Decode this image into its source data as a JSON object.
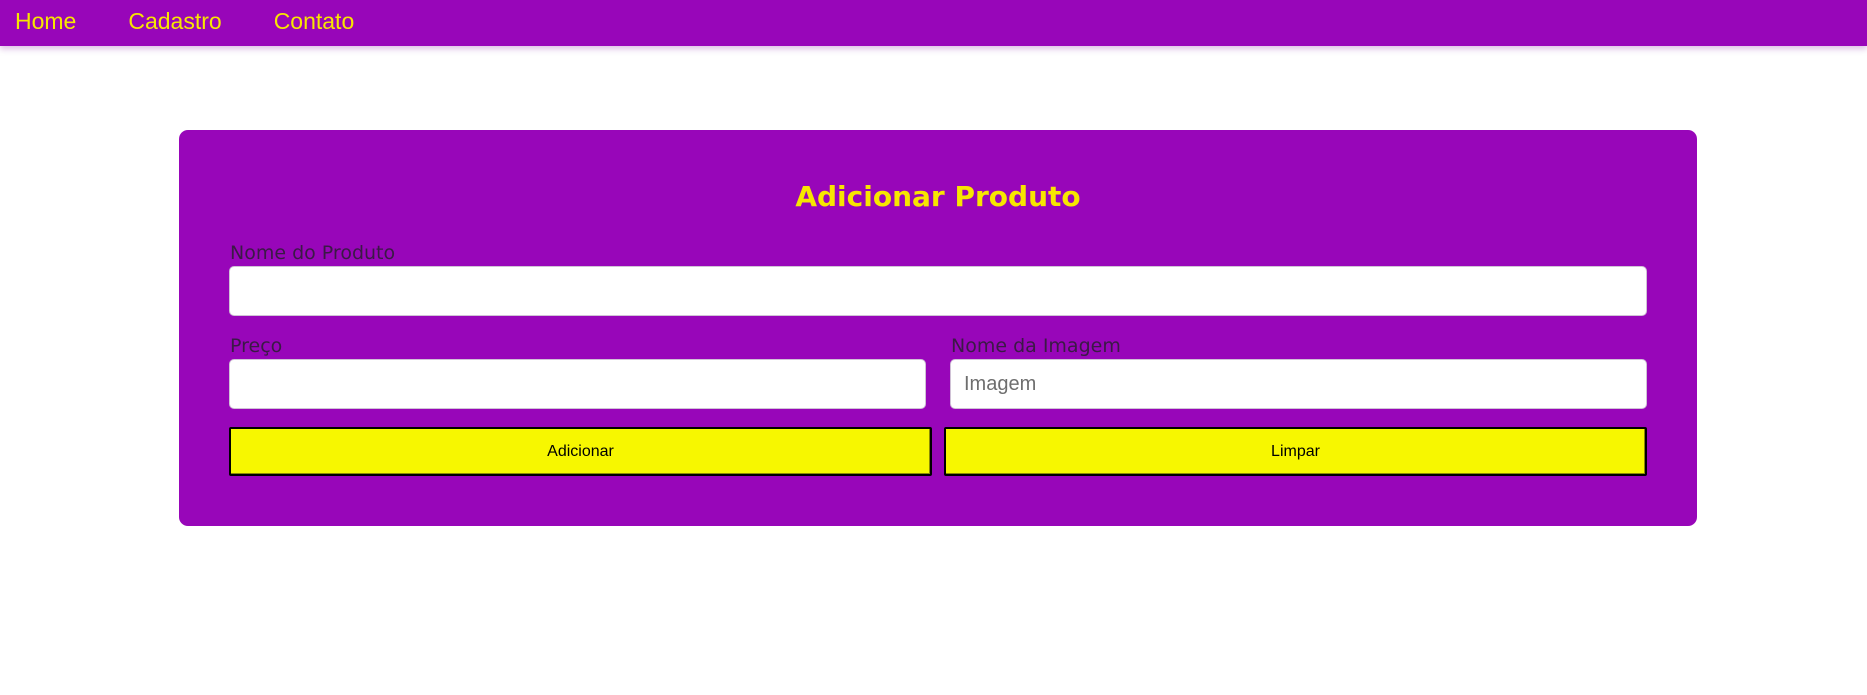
{
  "nav": {
    "home": "Home",
    "cadastro": "Cadastro",
    "contato": "Contato"
  },
  "form": {
    "title": "Adicionar Produto",
    "nome_label": "Nome do Produto",
    "nome_value": "",
    "nome_placeholder": "",
    "preco_label": "Preço",
    "preco_value": "",
    "preco_placeholder": "",
    "imagem_label": "Nome da Imagem",
    "imagem_value": "",
    "imagem_placeholder": "Imagem",
    "adicionar_label": "Adicionar",
    "limpar_label": "Limpar"
  },
  "colors": {
    "brand_purple": "#9806b9",
    "accent_yellow": "#f7e600",
    "button_yellow": "#f7f700"
  }
}
